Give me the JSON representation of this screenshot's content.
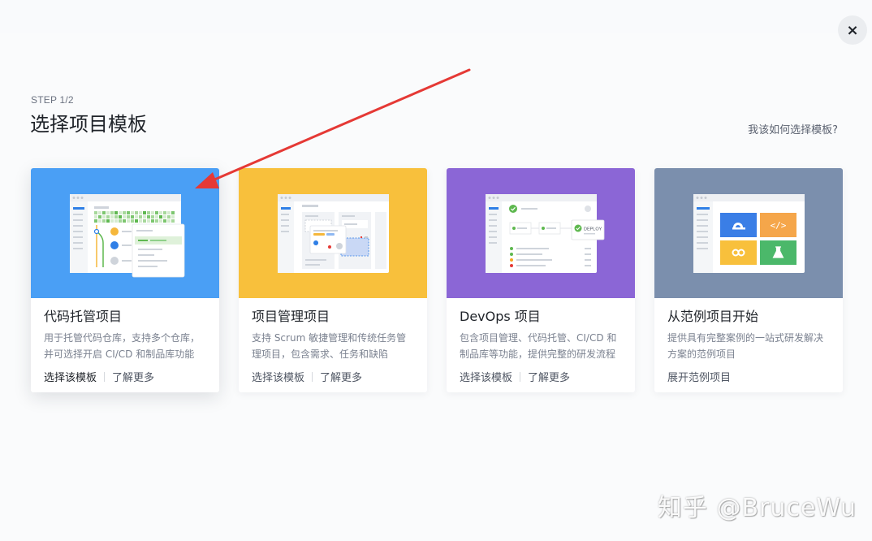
{
  "modal": {
    "step": "STEP 1/2",
    "title": "选择项目模板",
    "help_link": "我该如何选择模板?",
    "close_label": "×"
  },
  "cards": [
    {
      "title": "代码托管项目",
      "desc": "用于托管代码仓库，支持多个仓库，并可选择开启 CI/CD 和制品库功能",
      "primary_action": "选择该模板",
      "secondary_action": "了解更多",
      "hero_color": "#4a9ff5"
    },
    {
      "title": "项目管理项目",
      "desc": "支持 Scrum 敏捷管理和传统任务管理项目，包含需求、任务和缺陷",
      "primary_action": "选择该模板",
      "secondary_action": "了解更多",
      "hero_color": "#f8c03c"
    },
    {
      "title": "DevOps 项目",
      "desc": "包含项目管理、代码托管、CI/CD 和制品库等功能，提供完整的研发流程",
      "primary_action": "选择该模板",
      "secondary_action": "了解更多",
      "hero_color": "#8b66d6",
      "illustration_label": "DEPLOY"
    },
    {
      "title": "从范例项目开始",
      "desc": "提供具有完整案例的一站式研发解决方案的范例项目",
      "primary_action": "展开范例项目",
      "hero_color": "#7b8fad"
    }
  ],
  "watermark": "知乎 @BruceWu",
  "colors": {
    "arrow": "#e53935"
  }
}
